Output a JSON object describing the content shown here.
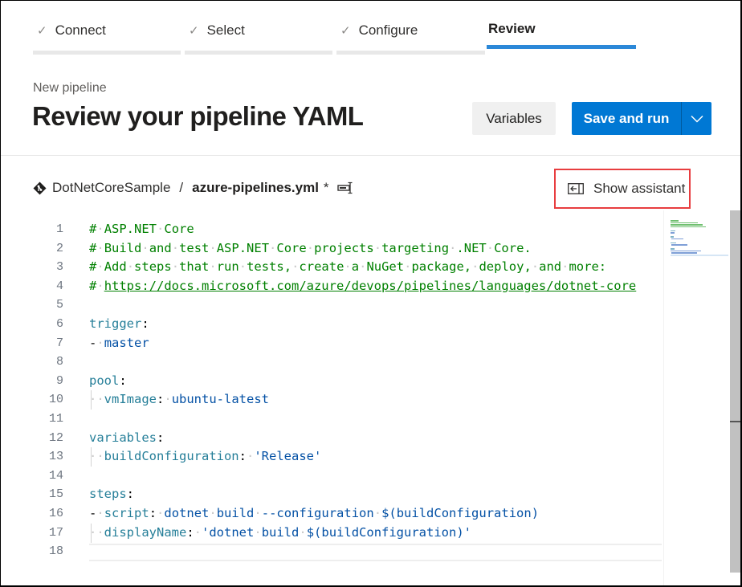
{
  "wizard": {
    "steps": [
      {
        "label": "Connect",
        "state": "done",
        "icon": "check-icon"
      },
      {
        "label": "Select",
        "state": "done",
        "icon": "check-icon"
      },
      {
        "label": "Configure",
        "state": "done",
        "icon": "check-icon"
      },
      {
        "label": "Review",
        "state": "active"
      }
    ],
    "active_color": "#2b88d8"
  },
  "header": {
    "subtitle": "New pipeline",
    "title": "Review your pipeline YAML",
    "variables_label": "Variables",
    "save_run_label": "Save and run",
    "save_dropdown_icon": "chevron-down-icon",
    "primary_color": "#0078d4"
  },
  "breadcrumb": {
    "repo_icon": "git-repo-icon",
    "repo": "DotNetCoreSample",
    "separator": "/",
    "file": "azure-pipelines.yml",
    "modified_marker": "*",
    "rename_icon": "rename-icon"
  },
  "assistant": {
    "label": "Show assistant",
    "icon": "panel-expand-icon",
    "highlight_color": "#e83d3f"
  },
  "editor": {
    "lines": [
      {
        "n": "1",
        "text": "# ASP.NET Core"
      },
      {
        "n": "2",
        "text": "# Build and test ASP.NET Core projects targeting .NET Core."
      },
      {
        "n": "3",
        "text": "# Add steps that run tests, create a NuGet package, deploy, and more:"
      },
      {
        "n": "4",
        "text": "# https://docs.microsoft.com/azure/devops/pipelines/languages/dotnet-core"
      },
      {
        "n": "5",
        "text": ""
      },
      {
        "n": "6",
        "text": "trigger:"
      },
      {
        "n": "7",
        "text": "- master"
      },
      {
        "n": "8",
        "text": ""
      },
      {
        "n": "9",
        "text": "pool:"
      },
      {
        "n": "10",
        "text": "  vmImage: ubuntu-latest"
      },
      {
        "n": "11",
        "text": ""
      },
      {
        "n": "12",
        "text": "variables:"
      },
      {
        "n": "13",
        "text": "  buildConfiguration: 'Release'"
      },
      {
        "n": "14",
        "text": ""
      },
      {
        "n": "15",
        "text": "steps:"
      },
      {
        "n": "16",
        "text": "- script: dotnet build --configuration $(buildConfiguration)"
      },
      {
        "n": "17",
        "text": "  displayName: 'dotnet build $(buildConfiguration)'"
      },
      {
        "n": "18",
        "text": ""
      }
    ],
    "tokens": {
      "l1": {
        "hash": "#",
        "text": "ASP.NET Core"
      },
      "l2": {
        "hash": "#",
        "text": "Build and test ASP.NET Core projects targeting .NET Core."
      },
      "l3": {
        "hash": "#",
        "text": "Add steps that run tests, create a NuGet package, deploy, and more:"
      },
      "l4": {
        "hash": "#",
        "url": "https://docs.microsoft.com/azure/devops/pipelines/languages/dotnet-core"
      },
      "l6": {
        "key": "trigger",
        "colon": ":"
      },
      "l7": {
        "dash": "-",
        "val": "master"
      },
      "l9": {
        "key": "pool",
        "colon": ":"
      },
      "l10": {
        "key": "vmImage",
        "colon": ":",
        "val": "ubuntu-latest"
      },
      "l12": {
        "key": "variables",
        "colon": ":"
      },
      "l13": {
        "key": "buildConfiguration",
        "colon": ":",
        "val": "'Release'"
      },
      "l15": {
        "key": "steps",
        "colon": ":"
      },
      "l16": {
        "dash": "-",
        "key": "script",
        "colon": ":",
        "val": "dotnet build --configuration $(buildConfiguration)"
      },
      "l17": {
        "key": "displayName",
        "colon": ":",
        "val": "'dotnet build $(buildConfiguration)'"
      }
    },
    "cursor_line": 18
  }
}
